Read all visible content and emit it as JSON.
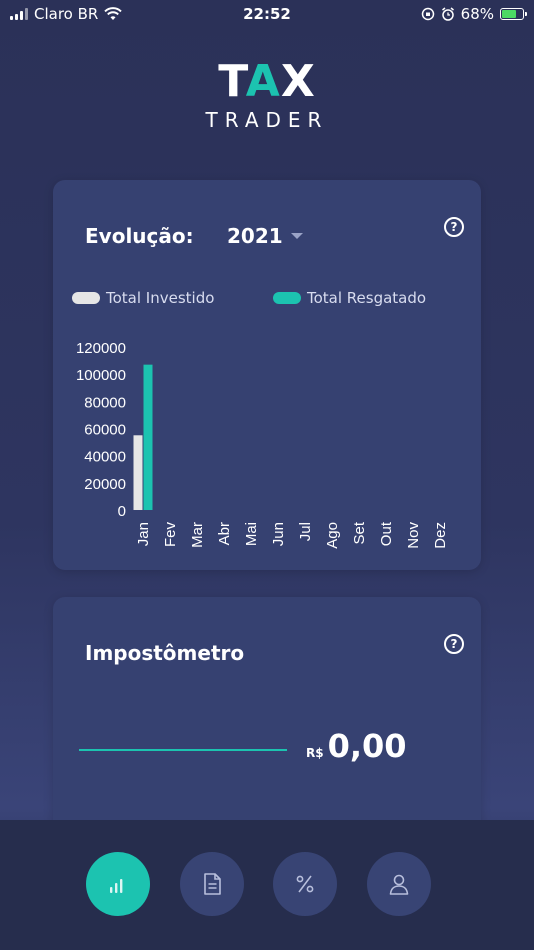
{
  "status_bar": {
    "carrier": "Claro BR",
    "time": "22:52",
    "battery_percent": "68%",
    "battery_level": 0.68
  },
  "logo": {
    "main_pre": "T",
    "main_mid": "A",
    "main_post": "X",
    "sub": "TRADER"
  },
  "evolution_card": {
    "title": "Evolução:",
    "year": "2021",
    "help_icon": "question-circle-icon"
  },
  "chart_data": {
    "type": "bar",
    "categories": [
      "Jan",
      "Fev",
      "Mar",
      "Abr",
      "Mai",
      "Jun",
      "Jul",
      "Ago",
      "Set",
      "Out",
      "Nov",
      "Dez"
    ],
    "series": [
      {
        "name": "Total Investido",
        "color": "#e6e6e6",
        "values": [
          55000,
          0,
          0,
          0,
          0,
          0,
          0,
          0,
          0,
          0,
          0,
          0
        ]
      },
      {
        "name": "Total Resgatado",
        "color": "#1cc3b0",
        "values": [
          107000,
          0,
          0,
          0,
          0,
          0,
          0,
          0,
          0,
          0,
          0,
          0
        ]
      }
    ],
    "yticks": [
      0,
      20000,
      40000,
      60000,
      80000,
      100000,
      120000
    ],
    "ylim": [
      0,
      120000
    ],
    "legend_position": "top",
    "grid": false
  },
  "impostometro_card": {
    "title": "Impostômetro",
    "currency": "R$",
    "amount": "0,00",
    "help_icon": "question-circle-icon"
  },
  "tabbar": {
    "tabs": [
      {
        "icon": "bar-chart-icon",
        "active": true
      },
      {
        "icon": "document-icon",
        "active": false
      },
      {
        "icon": "percent-icon",
        "active": false
      },
      {
        "icon": "user-icon",
        "active": false
      }
    ]
  },
  "colors": {
    "accent": "#1cc3b0",
    "card": "#364171",
    "background": "#2b3158"
  }
}
